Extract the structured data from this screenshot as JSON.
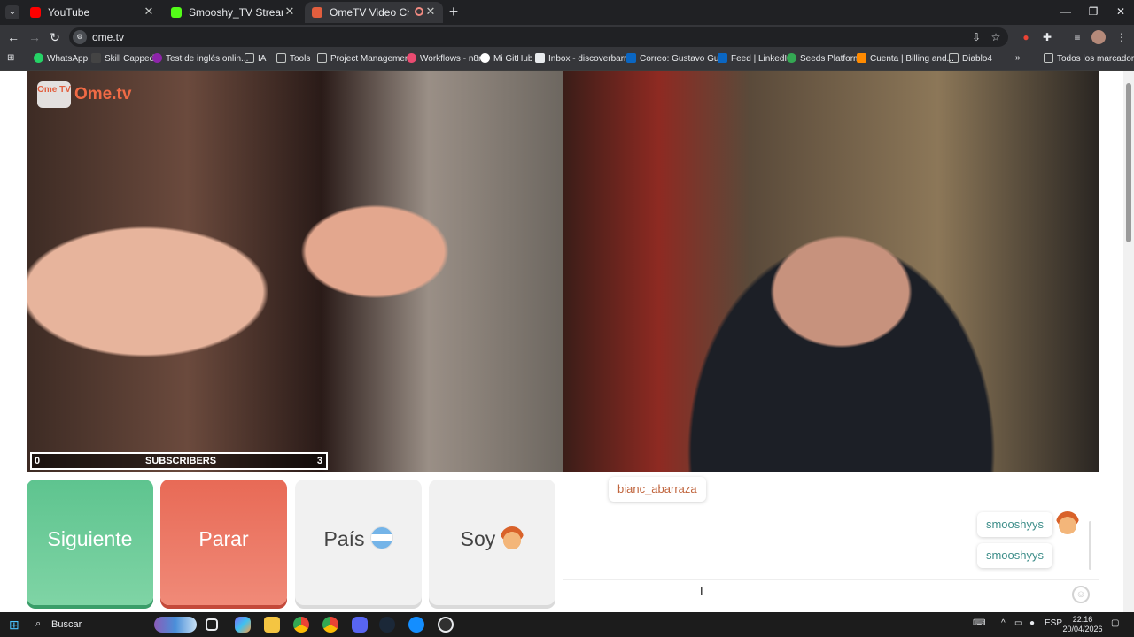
{
  "browser": {
    "tabs": [
      {
        "title": "YouTube",
        "favicon_color": "#ff0000",
        "active": false
      },
      {
        "title": "Smooshy_TV Stream - Watch Li",
        "favicon_color": "#53fc18",
        "active": false
      },
      {
        "title": "OmeTV Video Chat — Ome",
        "favicon_color": "#e25e3e",
        "active": true
      }
    ],
    "new_tab_label": "+",
    "url": "ome.tv",
    "bookmarks": [
      {
        "label": "WhatsApp",
        "color": "#25d366"
      },
      {
        "label": "Skill Capped",
        "color": "#1a1a1a"
      },
      {
        "label": "Test de inglés onlin...",
        "color": "#8e24aa"
      },
      {
        "label": "IA",
        "color": "#9aa0a6"
      },
      {
        "label": "Tools",
        "color": "#9aa0a6"
      },
      {
        "label": "Project Management",
        "color": "#9aa0a6"
      },
      {
        "label": "Workflows - n8n",
        "color": "#ea4b71"
      },
      {
        "label": "Mi GitHub",
        "color": "#ffffff"
      },
      {
        "label": "Inbox - discoverbarr...",
        "color": "#e8eaed"
      },
      {
        "label": "Correo: Gustavo Gu...",
        "color": "#0a66c2"
      },
      {
        "label": "Feed | LinkedIn",
        "color": "#0a66c2"
      },
      {
        "label": "Seeds Platform",
        "color": "#34a853"
      },
      {
        "label": "Cuenta | Billing and...",
        "color": "#ff8a00"
      },
      {
        "label": "Diablo4",
        "color": "#9aa0a6"
      }
    ],
    "all_bookmarks_label": "Todos los marcadores"
  },
  "app": {
    "logo_tv": "Ome TV",
    "logo_text": "Ome.tv",
    "subscribers": {
      "label": "SUBSCRIBERS",
      "min": "0",
      "max": "3"
    },
    "buttons": {
      "next": "Siguiente",
      "stop": "Parar",
      "country": "País",
      "gender": "Soy"
    },
    "chat": {
      "stranger_message": "bianc_abarraza",
      "my_messages": [
        "smooshyys",
        "smooshyys"
      ],
      "input_value": ""
    }
  },
  "taskbar": {
    "search_placeholder": "Buscar",
    "language": "ESP",
    "time": "22:16",
    "date": "20/04/2026",
    "apps": [
      {
        "name": "task-view",
        "color": "#e8eaed"
      },
      {
        "name": "copilot",
        "color": "#7b6cf6"
      },
      {
        "name": "file-explorer",
        "color": "#f4c542"
      },
      {
        "name": "chrome",
        "color": "#34a853"
      },
      {
        "name": "chrome-profile",
        "color": "#ea4335"
      },
      {
        "name": "discord",
        "color": "#5865f2"
      },
      {
        "name": "steam",
        "color": "#1b2838"
      },
      {
        "name": "battle-net",
        "color": "#148eff"
      },
      {
        "name": "obs",
        "color": "#303030"
      }
    ]
  }
}
